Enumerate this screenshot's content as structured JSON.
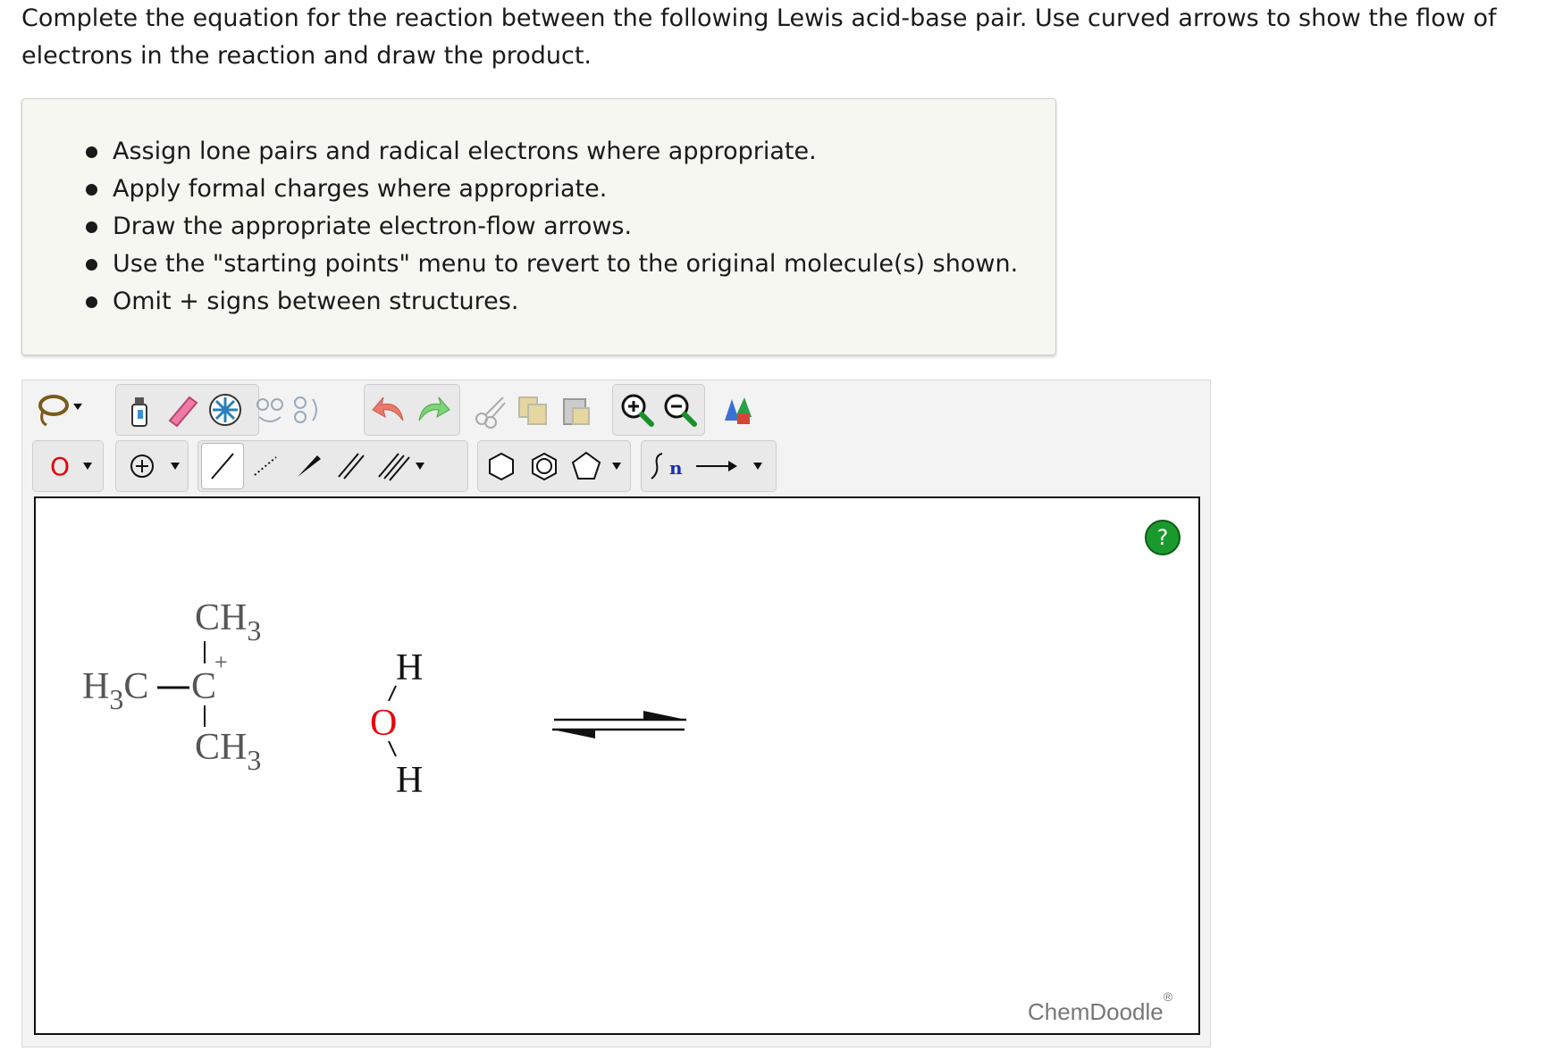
{
  "prompt": {
    "line1": "Complete the equation for the reaction between the following Lewis acid-base pair. Use curved arrows to show the flow of",
    "line2": "electrons in the reaction and draw the product."
  },
  "instructions": [
    "Assign lone pairs and radical electrons where appropriate.",
    "Apply formal charges where appropriate.",
    "Draw the appropriate electron-flow arrows.",
    "Use the \"starting points\" menu to revert to the original molecule(s) shown.",
    "Omit + signs between structures."
  ],
  "toolbar": {
    "row1": [
      "lasso-tool",
      "clear-tool",
      "eraser-tool",
      "center-tool",
      "flip-horizontal-tool",
      "flip-vertical-tool",
      "undo-tool",
      "redo-tool",
      "cut-tool",
      "copy-tool",
      "paste-tool",
      "zoom-in-tool",
      "zoom-out-tool",
      "templates-tool"
    ],
    "row2": [
      "atom-oxygen-tool",
      "charge-plus-tool",
      "single-bond-tool",
      "dashed-bond-tool",
      "wedge-bond-tool",
      "double-bond-tool",
      "triple-bond-tool",
      "cyclohexane-tool",
      "benzene-tool",
      "cyclopentane-tool",
      "repeat-unit-tool",
      "arrow-tool"
    ],
    "atom_label": "O",
    "repeat_label": "n"
  },
  "canvas": {
    "help_label": "?",
    "brand": "ChemDoodle",
    "brand_mark": "®"
  },
  "molecules": {
    "carbocation": {
      "top_group": "CH",
      "top_sub": "3",
      "left_group": "H",
      "left_sub": "3",
      "left_tail": "C",
      "center_atom": "C",
      "charge": "+",
      "bottom_group": "CH",
      "bottom_sub": "3"
    },
    "water": {
      "h_top": "H",
      "oxygen": "O",
      "h_bottom": "H"
    }
  },
  "colors": {
    "oxygen": "#e8000b",
    "atom_text": "#555555",
    "help_green": "#1a9a2c",
    "instructions_bg": "#f7f7f2"
  }
}
